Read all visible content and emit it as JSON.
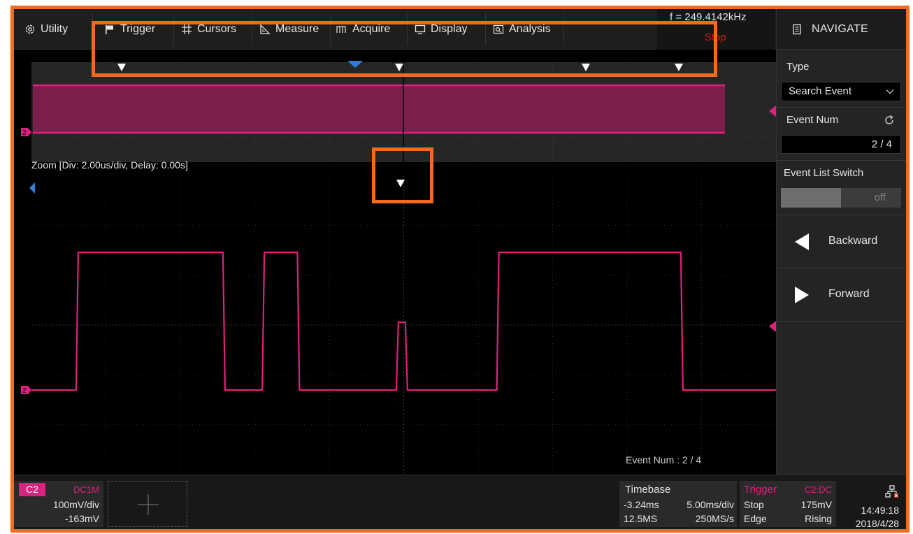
{
  "menu": {
    "utility": "Utility",
    "trigger": "Trigger",
    "cursors": "Cursors",
    "measure": "Measure",
    "acquire": "Acquire",
    "display": "Display",
    "analysis": "Analysis"
  },
  "status": {
    "frequency": "f = 249.4142kHz",
    "run_state": "Stop"
  },
  "panel": {
    "title": "NAVIGATE",
    "type_label": "Type",
    "type_value": "Search Event",
    "event_num_label": "Event Num",
    "event_num_value": "2 / 4",
    "event_list_label": "Event List Switch",
    "event_list_value": "off",
    "backward": "Backward",
    "forward": "Forward"
  },
  "waveform": {
    "zoom_label": "Zoom [Div: 2.00us/div,  Delay: 0.00s]",
    "event_num_overlay": "Event Num : 2 / 4",
    "channel_marker": "2",
    "trace_color": "#e0207e",
    "zoom_pulses": [
      {
        "start_div": 0.6,
        "end_div": 2.6,
        "level": "high"
      },
      {
        "start_div": 3.1,
        "end_div": 3.6,
        "level": "high"
      },
      {
        "start_div": 4.9,
        "end_div": 5.05,
        "level": "runt"
      },
      {
        "start_div": 6.25,
        "end_div": 8.75,
        "level": "high"
      }
    ]
  },
  "channel": {
    "tag": "C2",
    "coupling": "DC1M",
    "vdiv": "100mV/div",
    "offset": "-163mV"
  },
  "timebase": {
    "title": "Timebase",
    "delay": "-3.24ms",
    "tdiv": "5.00ms/div",
    "mem": "12.5MS",
    "srate": "250MS/s"
  },
  "trigger": {
    "title": "Trigger",
    "source": "C2:DC",
    "state": "Stop",
    "level": "175mV",
    "type": "Edge",
    "slope": "Rising"
  },
  "clock": {
    "time": "14:49:18",
    "date": "2018/4/28"
  },
  "colors": {
    "highlight": "#f26b1d",
    "channel": "#e0207e",
    "stop": "#d01818",
    "marker_blue": "#2f7fd6"
  }
}
